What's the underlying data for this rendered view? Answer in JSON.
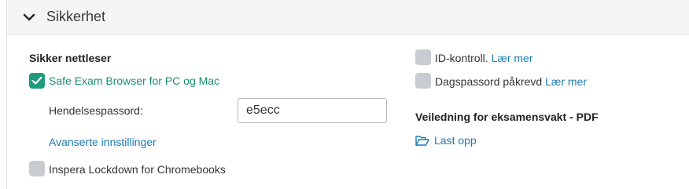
{
  "section": {
    "title": "Sikkerhet"
  },
  "secure_browser": {
    "heading": "Sikker nettleser",
    "seb_label": "Safe Exam Browser for PC og Mac",
    "seb_checked": true,
    "password_label": "Hendelsespassord:",
    "password_value": "e5ecc",
    "advanced_link": "Avanserte innstillinger",
    "lockdown_label": "Inspera Lockdown for Chromebooks",
    "lockdown_checked": false
  },
  "right": {
    "id_control_label": "ID-kontroll.",
    "id_control_link": "Lær mer",
    "day_password_label": "Dagspassord påkrevd",
    "day_password_link": "Lær mer",
    "guide_heading": "Veiledning for eksamensvakt - PDF",
    "upload_link": "Last opp"
  },
  "colors": {
    "accent_green": "#1f9a7c",
    "link_blue": "#1a7ab5",
    "checkbox_off": "#c9ccd1"
  },
  "icons": [
    "chevron-down-icon",
    "checkmark-icon",
    "folder-open-icon"
  ]
}
